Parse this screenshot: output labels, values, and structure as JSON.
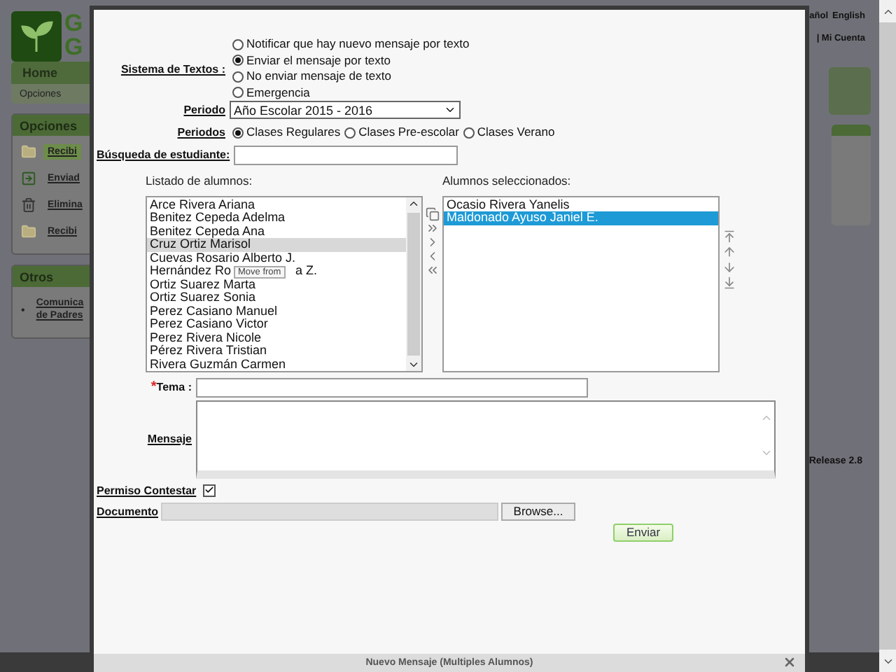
{
  "background": {
    "logo_letters": [
      "G",
      "G"
    ],
    "language": [
      "añol",
      "English"
    ],
    "account": "| Mi Cuenta",
    "nav": {
      "tab": "Home",
      "subtab": "Opciones"
    },
    "panels": [
      {
        "title": "Opciones",
        "items": [
          {
            "kind": "folder",
            "lines": [
              "Recibi"
            ],
            "selected": true
          },
          {
            "kind": "send",
            "lines": [
              "Enviad"
            ],
            "selected": false
          },
          {
            "kind": "trash",
            "lines": [
              "Elimina"
            ],
            "selected": false
          },
          {
            "kind": "folder",
            "lines": [
              "Recibi"
            ],
            "selected": false
          }
        ]
      },
      {
        "title": "Otros",
        "items": [
          {
            "kind": "bullet",
            "bullet": "•",
            "lines": [
              "Comunica",
              "de Padres"
            ],
            "selected": false
          }
        ]
      }
    ],
    "release": "Release 2.8"
  },
  "dialog": {
    "title": "Nuevo Mensaje (Multiples Alumnos)",
    "text_system": {
      "label": "Sistema de Textos :",
      "options": [
        {
          "label": "Notificar que hay nuevo mensaje por texto",
          "selected": false
        },
        {
          "label": "Enviar el mensaje por texto",
          "selected": true
        },
        {
          "label": "No enviar mensaje de texto",
          "selected": false
        },
        {
          "label": "Emergencia",
          "selected": false
        }
      ]
    },
    "period": {
      "label": "Periodo",
      "value": "Año Escolar 2015 - 2016"
    },
    "periods": {
      "label": "Periodos",
      "options": [
        {
          "label": "Clases Regulares",
          "selected": true
        },
        {
          "label": "Clases Pre-escolar",
          "selected": false
        },
        {
          "label": "Clases Verano",
          "selected": false
        }
      ]
    },
    "search": {
      "label": "Búsqueda de estudiante:"
    },
    "available": {
      "label": "Listado de alumnos:",
      "focused": false,
      "tooltip": "Move from",
      "items": [
        {
          "parts": [
            "Arce Rivera Ariana"
          ],
          "selected": false
        },
        {
          "parts": [
            "Benitez Cepeda Adelma"
          ],
          "selected": false
        },
        {
          "parts": [
            "Benitez Cepeda Ana"
          ],
          "selected": false
        },
        {
          "parts": [
            "Cruz Ortiz Marisol"
          ],
          "selected": true
        },
        {
          "parts": [
            "Cuevas Rosario Alberto J."
          ],
          "selected": false
        },
        {
          "parts": [
            "Hernández Ro",
            "a Z."
          ],
          "selected": false
        },
        {
          "parts": [
            "Ortiz Suarez Marta"
          ],
          "selected": false
        },
        {
          "parts": [
            "Ortiz Suarez Sonia"
          ],
          "selected": false
        },
        {
          "parts": [
            "Perez Casiano Manuel"
          ],
          "selected": false
        },
        {
          "parts": [
            "Perez Casiano Victor"
          ],
          "selected": false
        },
        {
          "parts": [
            "Perez Rivera Nicole"
          ],
          "selected": false
        },
        {
          "parts": [
            "Pérez Rivera Tristian"
          ],
          "selected": false
        },
        {
          "parts": [
            "Rivera Guzmán Carmen"
          ],
          "selected": false
        }
      ]
    },
    "chosen": {
      "label": "Alumnos seleccionados:",
      "focused": true,
      "items": [
        {
          "parts": [
            "Ocasio Rivera Yanelis"
          ],
          "selected": false
        },
        {
          "parts": [
            "Maldonado Ayuso Janiel E."
          ],
          "selected": true
        }
      ]
    },
    "subject": {
      "required": "*",
      "label": "Tema :"
    },
    "message": {
      "label": "Mensaje"
    },
    "reply_permission": {
      "label": "Permiso Contestar",
      "checked": true
    },
    "document": {
      "label": "Documento",
      "button": "Browse..."
    },
    "send": "Enviar"
  }
}
